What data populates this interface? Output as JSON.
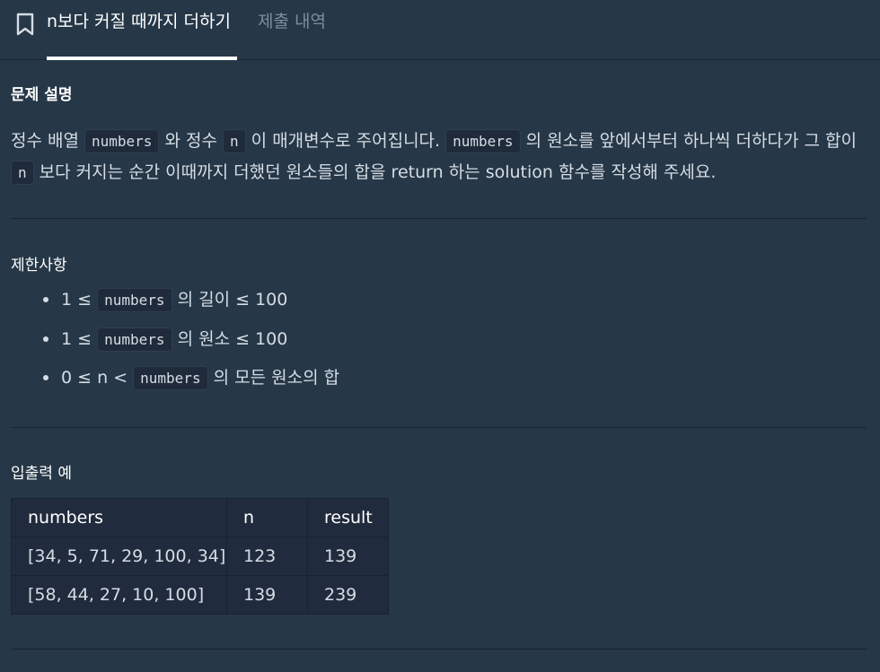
{
  "tabs": {
    "active_label": "n보다 커질 때까지 더하기",
    "submissions_label": "제출 내역"
  },
  "description": {
    "title": "문제 설명",
    "t1": "정수 배열 ",
    "c1": "numbers",
    "t2": " 와 정수 ",
    "c2": "n",
    "t3": " 이 매개변수로 주어집니다. ",
    "c3": "numbers",
    "t4": " 의 원소를 앞에서부터 하나씩 더하다가 그 합이 ",
    "c4": "n",
    "t5": " 보다 커지는 순간 이때까지 더했던 원소들의 합을 return 하는 solution 함수를 작성해 주세요."
  },
  "constraints": {
    "title": "제한사항",
    "items": [
      {
        "pre": "1 ≤ ",
        "code": "numbers",
        "post": " 의 길이 ≤ 100"
      },
      {
        "pre": "1 ≤ ",
        "code": "numbers",
        "post": " 의 원소 ≤ 100"
      },
      {
        "pre": "0 ≤ n < ",
        "code": "numbers",
        "post": " 의 모든 원소의 합"
      }
    ]
  },
  "examples": {
    "title": "입출력 예",
    "headers": [
      "numbers",
      "n",
      "result"
    ],
    "rows": [
      [
        "[34, 5, 71, 29, 100, 34]",
        "123",
        "139"
      ],
      [
        "[58, 44, 27, 10, 100]",
        "139",
        "239"
      ]
    ]
  }
}
